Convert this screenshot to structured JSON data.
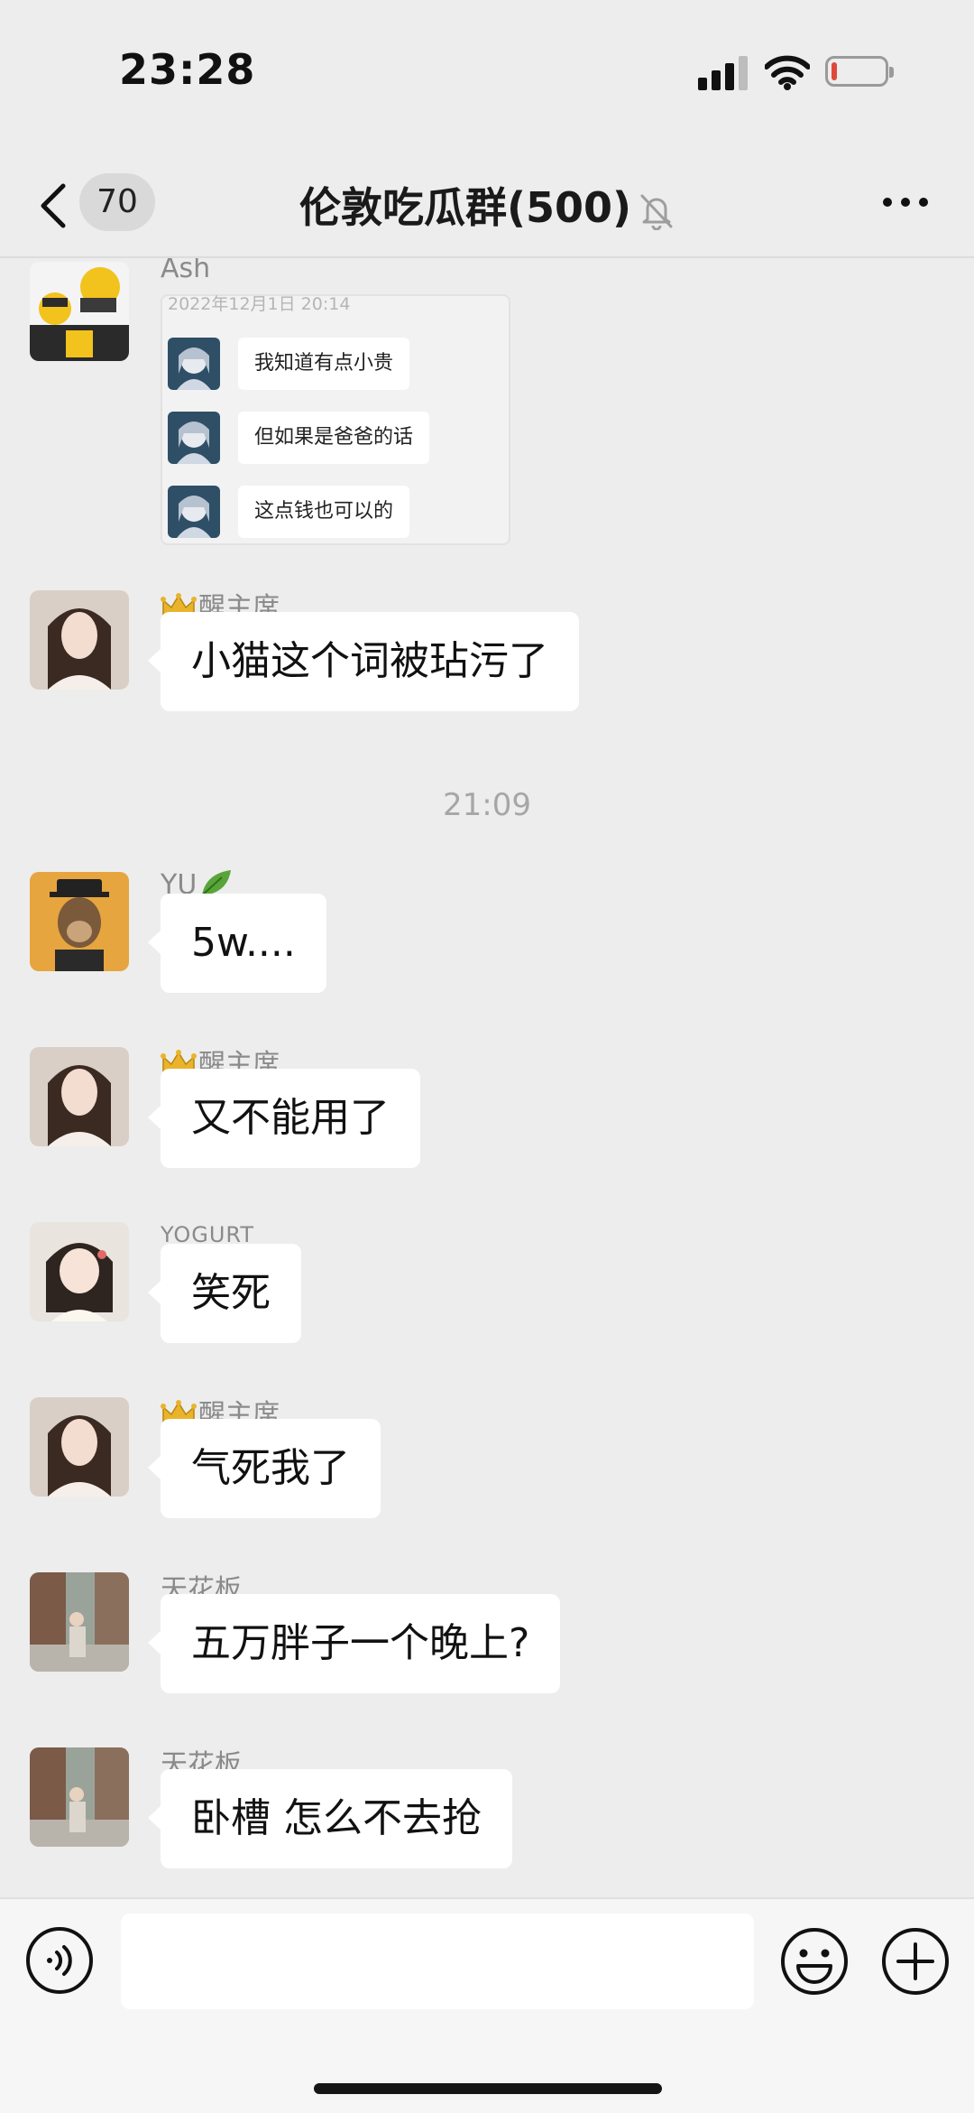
{
  "status_bar": {
    "time": "23:28",
    "battery_level": 0.1
  },
  "nav": {
    "back_icon": "chevron-left-icon",
    "unread_count": "70",
    "title": "伦敦吃瓜群(500)",
    "mute_icon": "bell-muted-icon",
    "more_icon": "more-dots-icon"
  },
  "chat": {
    "time_separator": "21:09",
    "messages": [
      {
        "sender": "Ash",
        "type": "image",
        "image": {
          "date": "2022年12月1日 20:14",
          "lines": [
            "我知道有点小贵",
            "但如果是爸爸的话",
            "这点钱也可以的"
          ]
        }
      },
      {
        "sender": "醒主席",
        "badge_icon": "crown-icon",
        "text": "小猫这个词被玷污了"
      },
      {
        "sender": "YU",
        "badge_icon": "leaf-icon",
        "text": "5w...."
      },
      {
        "sender": "醒主席",
        "badge_icon": "crown-icon",
        "text": "又不能用了"
      },
      {
        "sender": "YOGURT",
        "text": "笑死"
      },
      {
        "sender": "醒主席",
        "badge_icon": "crown-icon",
        "text": "气死我了"
      },
      {
        "sender": "天花板",
        "text": "五万胖子一个晚上?"
      },
      {
        "sender": "天花板",
        "text": "卧槽 怎么不去抢"
      }
    ]
  },
  "input_bar": {
    "voice_icon": "voice-input-icon",
    "input_value": "",
    "emoji_icon": "emoji-icon",
    "plus_icon": "plus-icon"
  },
  "colors": {
    "background": "#ededed",
    "bubble": "#ffffff",
    "battery_low": "#e0473b"
  }
}
